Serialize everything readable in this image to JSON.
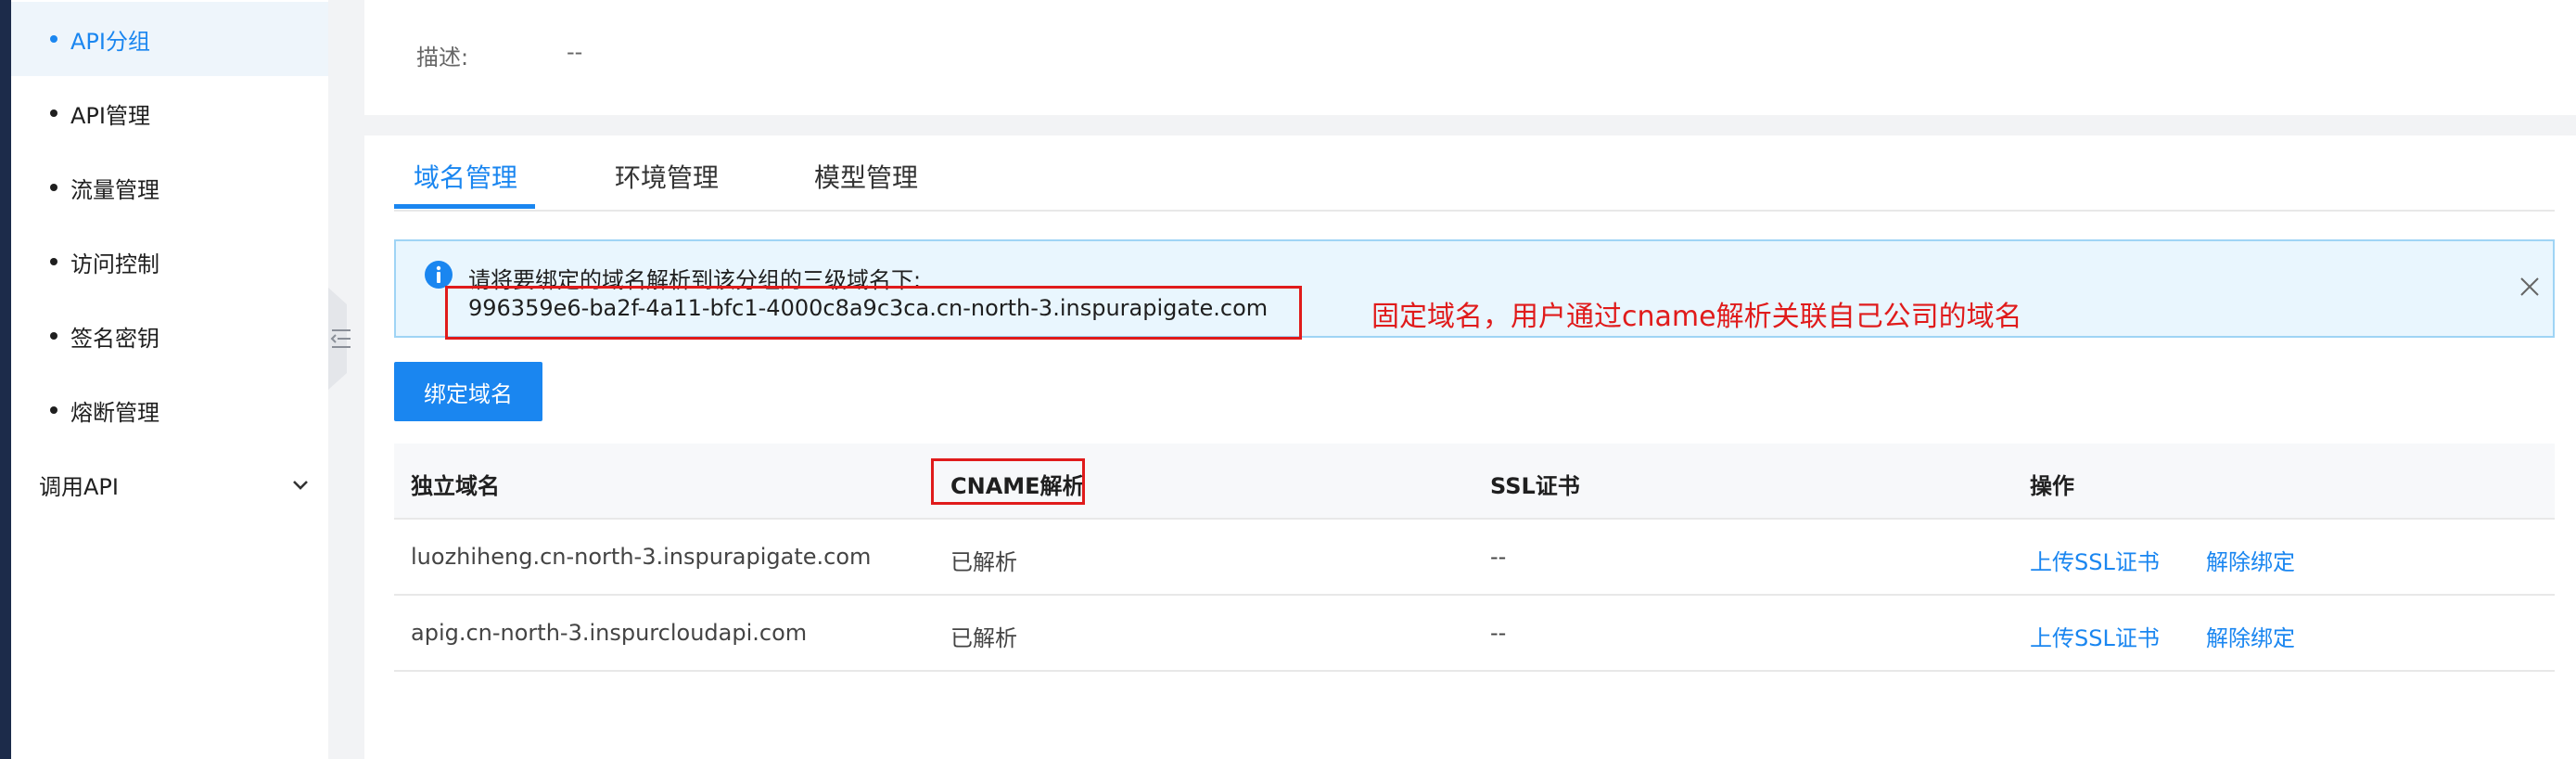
{
  "sidebar": {
    "items": [
      {
        "label": "API分组",
        "active": true
      },
      {
        "label": "API管理"
      },
      {
        "label": "流量管理"
      },
      {
        "label": "访问控制"
      },
      {
        "label": "签名密钥"
      },
      {
        "label": "熔断管理"
      }
    ],
    "group_label": "调用API"
  },
  "top": {
    "desc_label": "描述:",
    "desc_value": "--"
  },
  "tabs": [
    {
      "label": "域名管理",
      "active": true
    },
    {
      "label": "环境管理"
    },
    {
      "label": "模型管理"
    }
  ],
  "alert": {
    "text": "请将要绑定的域名解析到该分组的三级域名下:",
    "domain": "996359e6-ba2f-4a11-bfc1-4000c8a9c3ca.cn-north-3.inspurapigate.com"
  },
  "annotation": "固定域名，用户通过cname解析关联自己公司的域名",
  "bind_button": "绑定域名",
  "table": {
    "headers": [
      "独立域名",
      "CNAME解析",
      "SSL证书",
      "操作"
    ],
    "rows": [
      {
        "domain": "luozhiheng.cn-north-3.inspurapigate.com",
        "cname": "已解析",
        "ssl": "--",
        "action_upload": "上传SSL证书",
        "action_unbind": "解除绑定"
      },
      {
        "domain": "apig.cn-north-3.inspurcloudapi.com",
        "cname": "已解析",
        "ssl": "--",
        "action_upload": "上传SSL证书",
        "action_unbind": "解除绑定"
      }
    ]
  },
  "colors": {
    "accent": "#1a86f0",
    "annotation_red": "#e01b1b",
    "alert_bg": "#e9f6fe",
    "nav_dark": "#1c2b4a"
  },
  "icons": [
    "info-icon",
    "close-icon",
    "chevron-down-icon",
    "collapse-sidebar-icon"
  ]
}
